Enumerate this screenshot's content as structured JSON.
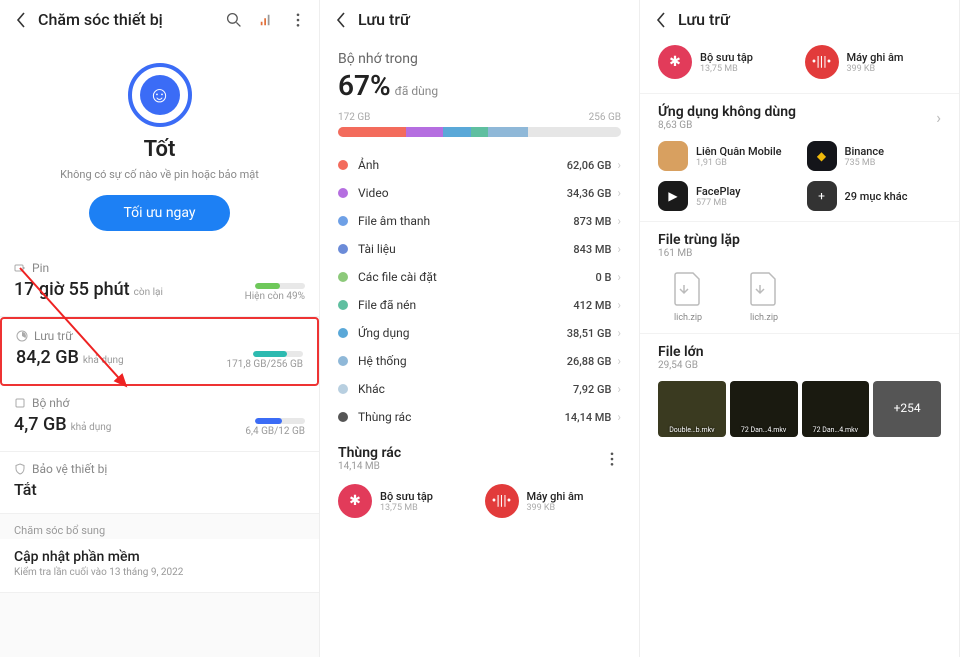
{
  "panel1": {
    "title": "Chăm sóc thiết bị",
    "status": "Tốt",
    "status_sub": "Không có sự cố nào về pin hoặc bảo mật",
    "optimize_btn": "Tối ưu ngay",
    "battery": {
      "label": "Pin",
      "value": "17 giờ 55 phút",
      "suffix": "còn lại",
      "right": "Hiện còn 49%",
      "pct": 49,
      "color": "#6ec85a"
    },
    "storage": {
      "label": "Lưu trữ",
      "value": "84,2 GB",
      "suffix": "khả dụng",
      "right_used": "171,8 GB",
      "right_total": "/256 GB",
      "pct": 67,
      "color": "#2dbab0"
    },
    "memory": {
      "label": "Bộ nhớ",
      "value": "4,7 GB",
      "suffix": "khả dụng",
      "right_used": "6,4 GB",
      "right_total": "/12 GB",
      "pct": 53,
      "color": "#3b6cf6"
    },
    "protect": {
      "label": "Bảo vệ thiết bị",
      "value": "Tắt"
    },
    "extra_title": "Chăm sóc bổ sung",
    "update": {
      "title": "Cập nhật phần mềm",
      "sub": "Kiểm tra lần cuối vào 13 tháng 9, 2022"
    }
  },
  "panel2": {
    "title": "Lưu trữ",
    "heading": "Bộ nhớ trong",
    "percent": "67%",
    "percent_sub": "đã dùng",
    "used": "172 GB",
    "total": "256 GB",
    "segments": [
      {
        "color": "#f36b5c",
        "w": 24
      },
      {
        "color": "#b56ee0",
        "w": 13
      },
      {
        "color": "#5aa8d8",
        "w": 10
      },
      {
        "color": "#5fbfa0",
        "w": 6
      },
      {
        "color": "#8fb8d8",
        "w": 14
      }
    ],
    "cats": [
      {
        "color": "#f36b5c",
        "name": "Ảnh",
        "val": "62,06 GB"
      },
      {
        "color": "#b56ee0",
        "name": "Video",
        "val": "34,36 GB"
      },
      {
        "color": "#6ea0e6",
        "name": "File âm thanh",
        "val": "873 MB"
      },
      {
        "color": "#6b8bd8",
        "name": "Tài liệu",
        "val": "843 MB"
      },
      {
        "color": "#8cc97a",
        "name": "Các file cài đặt",
        "val": "0 B"
      },
      {
        "color": "#5fbfa0",
        "name": "File đã nén",
        "val": "412 MB"
      },
      {
        "color": "#5aa8d8",
        "name": "Ứng dụng",
        "val": "38,51 GB"
      },
      {
        "color": "#8fb8d8",
        "name": "Hệ thống",
        "val": "26,88 GB"
      },
      {
        "color": "#b8cfe0",
        "name": "Khác",
        "val": "7,92 GB"
      },
      {
        "color": "#555",
        "name": "Thùng rác",
        "val": "14,14 MB"
      }
    ],
    "trash": {
      "title": "Thùng rác",
      "sub": "14,14 MB"
    },
    "trash_apps": [
      {
        "name": "Bộ sưu tập",
        "sub": "13,75 MB",
        "bg": "#e23b5a",
        "icon": "✱"
      },
      {
        "name": "Máy ghi âm",
        "sub": "399 KB",
        "bg": "#e23b3b",
        "icon": "•|||•"
      }
    ]
  },
  "panel3": {
    "title": "Lưu trữ",
    "top_apps": [
      {
        "name": "Bộ sưu tập",
        "sub": "13,75 MB",
        "bg": "#e23b5a",
        "icon": "✱"
      },
      {
        "name": "Máy ghi âm",
        "sub": "399 KB",
        "bg": "#e23b3b",
        "icon": "•|||•"
      }
    ],
    "unused": {
      "title": "Ứng dụng không dùng",
      "sub": "8,63 GB"
    },
    "unused_apps": [
      {
        "name": "Liên Quân Mobile",
        "sub": "1,91 GB",
        "bg": "#d8a060"
      },
      {
        "name": "Binance",
        "sub": "735 MB",
        "bg": "#14151a",
        "fg": "#f0b90b",
        "icon": "◆"
      },
      {
        "name": "FacePlay",
        "sub": "577 MB",
        "bg": "#1a1a1a",
        "icon": "▶"
      },
      {
        "name": "29 mục khác",
        "sub": "",
        "bg": "#333",
        "icon": "+"
      }
    ],
    "dup": {
      "title": "File trùng lặp",
      "sub": "161 MB"
    },
    "dup_files": [
      {
        "name": "lich.zip"
      },
      {
        "name": "lich.zip"
      }
    ],
    "large": {
      "title": "File lớn",
      "sub": "29,54 GB"
    },
    "thumbs": [
      {
        "label": "Double…b.mkv"
      },
      {
        "label": "72 Dan…4.mkv"
      },
      {
        "label": "72 Dan…4.mkv"
      },
      {
        "label": "+254"
      }
    ]
  }
}
